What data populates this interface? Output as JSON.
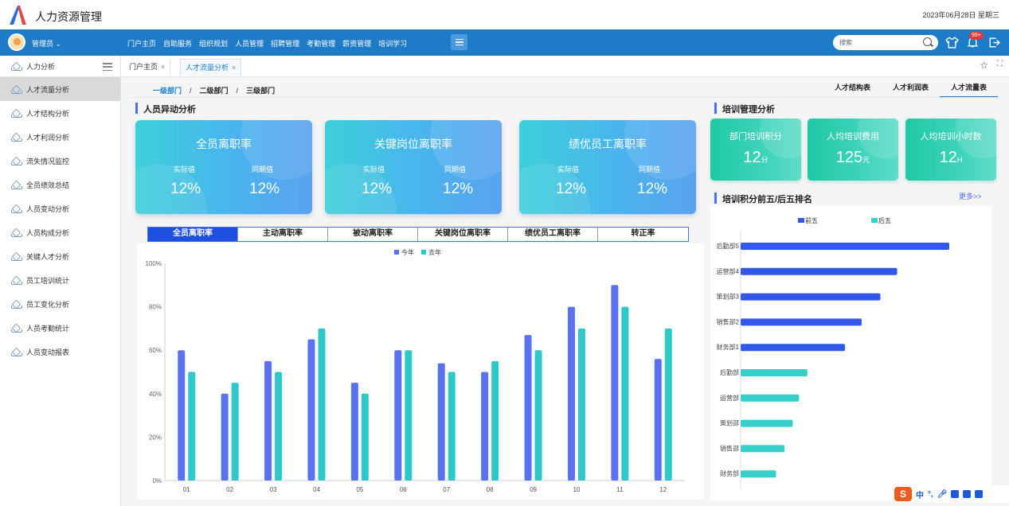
{
  "app": {
    "title": "人力资源管理",
    "date": "2023年06月28日  星期三"
  },
  "navbar": {
    "user": "管理员",
    "items": [
      "门户主页",
      "自助服务",
      "组织规划",
      "人员管理",
      "招聘管理",
      "考勤管理",
      "薪资管理",
      "培训学习"
    ],
    "search_placeholder": "搜索",
    "badge": "99+"
  },
  "sidebar": {
    "header": "人力分析",
    "items": [
      "人才流量分析",
      "人才结构分析",
      "人才利润分析",
      "流失情况监控",
      "全员绩效总结",
      "人员变动分析",
      "人员构成分析",
      "关键人才分析",
      "员工培训统计",
      "员工变化分析",
      "人员考勤统计",
      "人员变动报表"
    ],
    "active_index": 0
  },
  "tabs": [
    {
      "label": "门户主页",
      "active": false
    },
    {
      "label": "人才流量分析",
      "active": true
    }
  ],
  "breadcrumb": [
    "一级部门",
    "二级部门",
    "三级部门"
  ],
  "right_tabs": [
    "人才结构表",
    "人才利润表",
    "人才流量表"
  ],
  "right_tabs_active": 2,
  "section1_title": "人员异动分析",
  "section2_title": "培训管理分析",
  "section3_title": "培训积分前五/后五排名",
  "more_label": "更多>>",
  "cards": [
    {
      "title": "全员离职率",
      "actual_label": "实际值",
      "actual": "12%",
      "prior_label": "同期值",
      "prior": "12%"
    },
    {
      "title": "关键岗位离职率",
      "actual_label": "实际值",
      "actual": "12%",
      "prior_label": "同期值",
      "prior": "12%"
    },
    {
      "title": "绩优员工离职率",
      "actual_label": "实际值",
      "actual": "12%",
      "prior_label": "同期值",
      "prior": "12%"
    }
  ],
  "training_cards": [
    {
      "title": "部门培训积分",
      "value": "12",
      "unit": "分"
    },
    {
      "title": "人均培训费用",
      "value": "125",
      "unit": "元"
    },
    {
      "title": "人均培训小时数",
      "value": "12",
      "unit": "H"
    }
  ],
  "filter_tabs": [
    "全员离职率",
    "主动离职率",
    "被动离职率",
    "关键岗位离职率",
    "绩优员工离职率",
    "转正率"
  ],
  "filter_active": 0,
  "taskbar": {
    "ime": "中",
    "symbol": "°,"
  },
  "colors": {
    "nav": "#1e7bc8",
    "this_year": "#5b72f0",
    "last_year": "#2fc8c8",
    "top5": "#3158e8",
    "bottom5": "#36cfc9"
  },
  "chart_data": [
    {
      "type": "bar",
      "categories": [
        "01",
        "02",
        "03",
        "04",
        "05",
        "06",
        "07",
        "08",
        "09",
        "10",
        "11",
        "12"
      ],
      "series": [
        {
          "name": "今年",
          "values": [
            60,
            40,
            55,
            65,
            45,
            60,
            54,
            50,
            67,
            80,
            90,
            56
          ]
        },
        {
          "name": "去年",
          "values": [
            50,
            45,
            50,
            70,
            40,
            60,
            50,
            55,
            60,
            70,
            80,
            70
          ]
        }
      ],
      "ylim": [
        0,
        100
      ],
      "yticks": [
        "0%",
        "20%",
        "40%",
        "60%",
        "80%",
        "100%"
      ],
      "legend": "top-center",
      "grid": false
    },
    {
      "type": "bar",
      "orientation": "horizontal",
      "categories": [
        "后勤部5",
        "运营部4",
        "策划部3",
        "销售部2",
        "财务部1",
        "后勤部",
        "运营部",
        "策划部",
        "销售部",
        "财务部"
      ],
      "series": [
        {
          "name": "前五",
          "values": [
            100,
            75,
            67,
            58,
            50,
            null,
            null,
            null,
            null,
            null
          ]
        },
        {
          "name": "后五",
          "values": [
            null,
            null,
            null,
            null,
            null,
            32,
            28,
            25,
            21,
            17
          ]
        }
      ],
      "legend": "top-center",
      "grid": false
    }
  ]
}
